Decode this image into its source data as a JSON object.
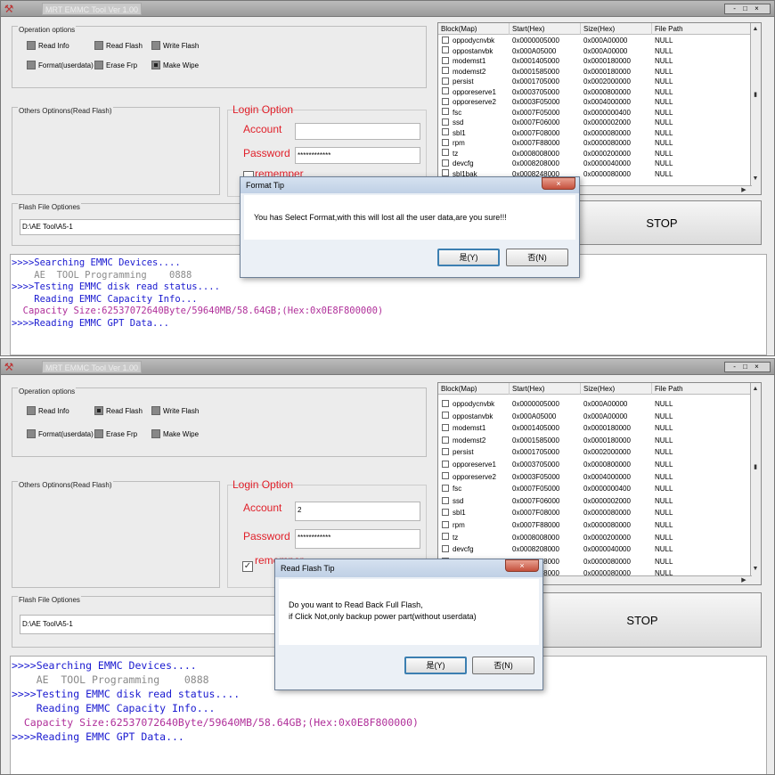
{
  "windows": [
    {
      "title": "MRT EMMC Tool Ver 1.00",
      "controls": "- □ ×",
      "operation_options": {
        "title": "Operation options",
        "items": [
          {
            "label": "Read Info",
            "checked": false
          },
          {
            "label": "Read Flash",
            "checked": false
          },
          {
            "label": "Write Flash",
            "checked": false
          },
          {
            "label": "Format(userdata)",
            "checked": false
          },
          {
            "label": "Erase Frp",
            "checked": false
          },
          {
            "label": "Make Wipe",
            "checked": true
          }
        ]
      },
      "others_options_title": "Others Optinons(Read Flash)",
      "login": {
        "title": "Login Option",
        "account_label": "Account",
        "account_value": "",
        "password_label": "Password",
        "password_value": "************",
        "remember_label": "rememper",
        "remember_checked": false
      },
      "flash_file": {
        "title": "Flash File Optiones",
        "path": "D:\\AE Tool\\A5-1"
      },
      "stop_label": "STOP",
      "table": {
        "headers": [
          "Block(Map)",
          "Start(Hex)",
          "Size(Hex)",
          "File Path"
        ],
        "rows": [
          [
            "oppodycnvbk",
            "0x0000005000",
            "0x000A00000",
            "NULL"
          ],
          [
            "oppostanvbk",
            "0x000A05000",
            "0x000A00000",
            "NULL"
          ],
          [
            "modemst1",
            "0x0001405000",
            "0x0000180000",
            "NULL"
          ],
          [
            "modemst2",
            "0x0001585000",
            "0x0000180000",
            "NULL"
          ],
          [
            "persist",
            "0x0001705000",
            "0x0002000000",
            "NULL"
          ],
          [
            "opporeserve1",
            "0x0003705000",
            "0x0000800000",
            "NULL"
          ],
          [
            "opporeserve2",
            "0x0003F05000",
            "0x0004000000",
            "NULL"
          ],
          [
            "fsc",
            "0x0007F05000",
            "0x0000000400",
            "NULL"
          ],
          [
            "ssd",
            "0x0007F06000",
            "0x0000002000",
            "NULL"
          ],
          [
            "sbl1",
            "0x0007F08000",
            "0x0000080000",
            "NULL"
          ],
          [
            "rpm",
            "0x0007F88000",
            "0x0000080000",
            "NULL"
          ],
          [
            "tz",
            "0x0008008000",
            "0x0000200000",
            "NULL"
          ],
          [
            "devcfg",
            "0x0008208000",
            "0x0000040000",
            "NULL"
          ],
          [
            "sbl1bak",
            "0x0008248000",
            "0x0000080000",
            "NULL"
          ]
        ]
      },
      "log": [
        {
          "text": ">>>>Searching EMMC Devices....",
          "color": "#1a1ad0"
        },
        {
          "text": "    AE  TOOL Programming    0888",
          "color": "#8a8a8a"
        },
        {
          "text": ">>>>Testing EMMC disk read status....",
          "color": "#1a1ad0"
        },
        {
          "text": "    Reading EMMC Capacity Info...",
          "color": "#1a1ad0"
        },
        {
          "text": "  Capacity Size:62537072640Byte/59640MB/58.64GB;(Hex:0x0E8F800000)",
          "color": "#b0309a"
        },
        {
          "text": ">>>>Reading EMMC GPT Data...",
          "color": "#1a1ad0"
        }
      ],
      "dialog": {
        "title": "Format Tip",
        "close": "×",
        "message_lines": [
          "You has Select Format,with this will lost all the user data,are you sure!!!"
        ],
        "yes_label": "是(Y)",
        "no_label": "否(N)"
      }
    },
    {
      "title": "MRT EMMC Tool Ver 1.00",
      "controls": "- □ ×",
      "operation_options": {
        "title": "Operation options",
        "items": [
          {
            "label": "Read Info",
            "checked": false
          },
          {
            "label": "Read Flash",
            "checked": true
          },
          {
            "label": "Write Flash",
            "checked": false
          },
          {
            "label": "Format(userdata)",
            "checked": false
          },
          {
            "label": "Erase Frp",
            "checked": false
          },
          {
            "label": "Make Wipe",
            "checked": false
          }
        ]
      },
      "others_options_title": "Others Optinons(Read Flash)",
      "login": {
        "title": "Login Option",
        "account_label": "Account",
        "account_value": "2",
        "password_label": "Password",
        "password_value": "************",
        "remember_label": "rememper",
        "remember_checked": true
      },
      "flash_file": {
        "title": "Flash File Optiones",
        "path": "D:\\AE Tool\\A5-1"
      },
      "stop_label": "STOP",
      "table": {
        "headers": [
          "Block(Map)",
          "Start(Hex)",
          "Size(Hex)",
          "File Path"
        ],
        "rows": [
          [
            "oppodycnvbk",
            "0x0000005000",
            "0x000A00000",
            "NULL"
          ],
          [
            "oppostanvbk",
            "0x000A05000",
            "0x000A00000",
            "NULL"
          ],
          [
            "modemst1",
            "0x0001405000",
            "0x0000180000",
            "NULL"
          ],
          [
            "modemst2",
            "0x0001585000",
            "0x0000180000",
            "NULL"
          ],
          [
            "persist",
            "0x0001705000",
            "0x0002000000",
            "NULL"
          ],
          [
            "opporeserve1",
            "0x0003705000",
            "0x0000800000",
            "NULL"
          ],
          [
            "opporeserve2",
            "0x0003F05000",
            "0x0004000000",
            "NULL"
          ],
          [
            "fsc",
            "0x0007F05000",
            "0x0000000400",
            "NULL"
          ],
          [
            "ssd",
            "0x0007F06000",
            "0x0000002000",
            "NULL"
          ],
          [
            "sbl1",
            "0x0007F08000",
            "0x0000080000",
            "NULL"
          ],
          [
            "rpm",
            "0x0007F88000",
            "0x0000080000",
            "NULL"
          ],
          [
            "tz",
            "0x0008008000",
            "0x0000200000",
            "NULL"
          ],
          [
            "devcfg",
            "0x0008208000",
            "0x0000040000",
            "NULL"
          ],
          [
            "",
            "0x0008248000",
            "0x0000080000",
            "NULL"
          ],
          [
            "",
            "0x0008248000",
            "0x0000080000",
            "NULL"
          ]
        ]
      },
      "log": [
        {
          "text": ">>>>Searching EMMC Devices....",
          "color": "#1a1ad0"
        },
        {
          "text": "    AE  TOOL Programming    0888",
          "color": "#8a8a8a"
        },
        {
          "text": ">>>>Testing EMMC disk read status....",
          "color": "#1a1ad0"
        },
        {
          "text": "    Reading EMMC Capacity Info...",
          "color": "#1a1ad0"
        },
        {
          "text": "  Capacity Size:62537072640Byte/59640MB/58.64GB;(Hex:0x0E8F800000)",
          "color": "#b0309a"
        },
        {
          "text": ">>>>Reading EMMC GPT Data...",
          "color": "#1a1ad0"
        }
      ],
      "dialog": {
        "title": "Read Flash Tip",
        "close": "×",
        "message_lines": [
          "Do you want to Read Back Full Flash,",
          "if Click Not,only backup power part(without userdata)"
        ],
        "yes_label": "是(Y)",
        "no_label": "否(N)"
      }
    }
  ]
}
